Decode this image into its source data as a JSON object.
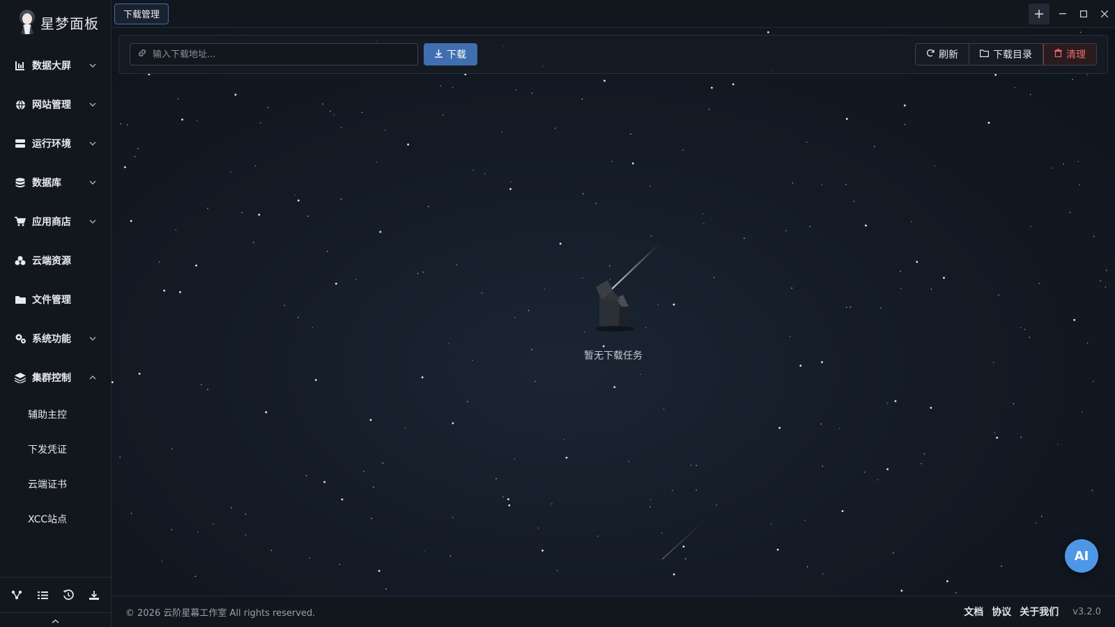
{
  "app": {
    "logo_text": "星梦面板"
  },
  "sidebar": {
    "items": [
      {
        "label": "数据大屏",
        "icon": "chart-bars-icon",
        "expandable": true
      },
      {
        "label": "网站管理",
        "icon": "globe-icon",
        "expandable": true
      },
      {
        "label": "运行环境",
        "icon": "server-icon",
        "expandable": true
      },
      {
        "label": "数据库",
        "icon": "database-icon",
        "expandable": true
      },
      {
        "label": "应用商店",
        "icon": "cart-icon",
        "expandable": true
      },
      {
        "label": "云端资源",
        "icon": "cloud-nodes-icon",
        "expandable": false
      },
      {
        "label": "文件管理",
        "icon": "folder-icon",
        "expandable": false
      },
      {
        "label": "系统功能",
        "icon": "gears-icon",
        "expandable": true
      },
      {
        "label": "集群控制",
        "icon": "layers-icon",
        "expandable": true,
        "expanded": true
      }
    ],
    "sub_items": [
      "辅助主控",
      "下发凭证",
      "云端证书",
      "XCC站点"
    ],
    "tools": [
      "cluster-icon",
      "list-icon",
      "history-icon",
      "download-icon"
    ]
  },
  "titlebar": {
    "active_tab": "下载管理"
  },
  "toolbar": {
    "url_placeholder": "输入下载地址...",
    "download_label": "下载",
    "refresh_label": "刷新",
    "download_dir_label": "下载目录",
    "clear_label": "清理"
  },
  "empty_state": {
    "text": "暂无下载任务"
  },
  "ai_button": {
    "label": "AI"
  },
  "footer": {
    "copyright": "© 2026 云阶星幕工作室 All rights reserved.",
    "links": [
      "文档",
      "协议",
      "关于我们"
    ],
    "version": "v3.2.0"
  },
  "colors": {
    "accent": "#3f6fb0",
    "danger": "#ef6b6b",
    "ai": "#4e97e6"
  }
}
